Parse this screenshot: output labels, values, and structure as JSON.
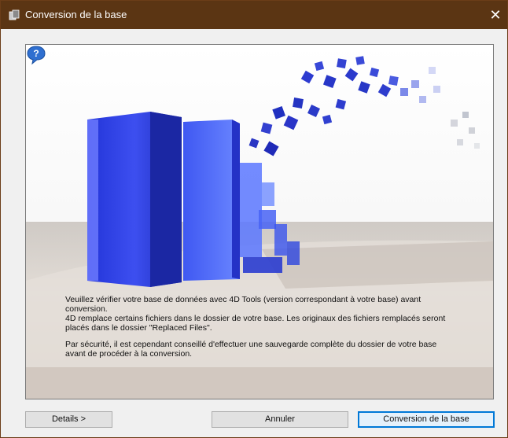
{
  "window": {
    "title": "Conversion de la base",
    "close_glyph": "✕"
  },
  "message": {
    "line1": "Veuillez vérifier votre base de données avec 4D Tools (version correspondant à votre base) avant",
    "line2": "conversion.",
    "line3": "4D remplace certains fichiers dans le dossier de votre base. Les originaux des fichiers remplacés seront",
    "line4": "placés dans le dossier \"Replaced Files\".",
    "line5": "Par sécurité, il est cependant conseillé d'effectuer une sauvegarde complète du dossier de votre base",
    "line6": "avant de procéder à la conversion."
  },
  "buttons": {
    "details": "Details >",
    "cancel": "Annuler",
    "convert": "Conversion de la base"
  },
  "icons": {
    "app": "database-app-icon",
    "help": "help-question-icon",
    "close": "close-icon"
  },
  "colors": {
    "titlebar": "#5b3513",
    "primary_border": "#0078d7"
  }
}
